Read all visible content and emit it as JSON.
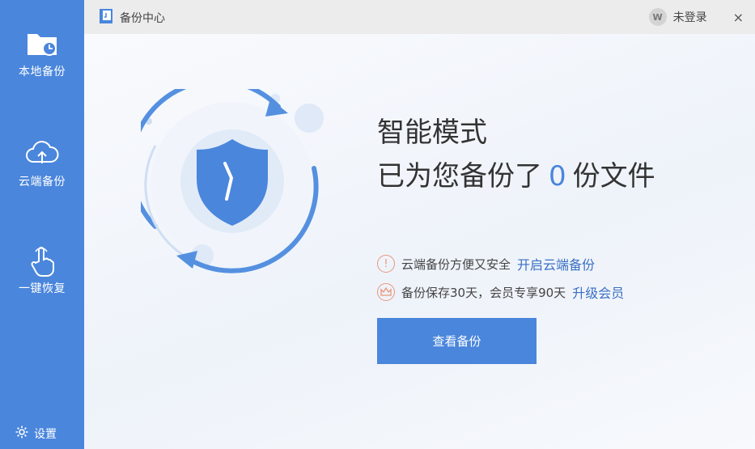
{
  "sidebar": {
    "items": [
      {
        "label": "本地备份",
        "icon": "folder-clock-icon"
      },
      {
        "label": "云端备份",
        "icon": "cloud-upload-icon"
      },
      {
        "label": "一键恢复",
        "icon": "hand-pointer-icon"
      }
    ],
    "settings_label": "设置"
  },
  "titlebar": {
    "title": "备份中心",
    "user_label": "未登录",
    "avatar_letter": "W",
    "close_glyph": "×"
  },
  "main": {
    "mode_title": "智能模式",
    "backup_prefix": "已为您备份了",
    "backup_count": "0",
    "backup_suffix": "份文件",
    "row1_text": "云端备份方便又安全",
    "row1_link": "开启云端备份",
    "row2_text": "备份保存30天，会员专享90天",
    "row2_link": "升级会员",
    "view_button": "查看备份"
  },
  "colors": {
    "accent": "#4a86dc",
    "link": "#3a6fc4",
    "warning": "#e9967a"
  }
}
